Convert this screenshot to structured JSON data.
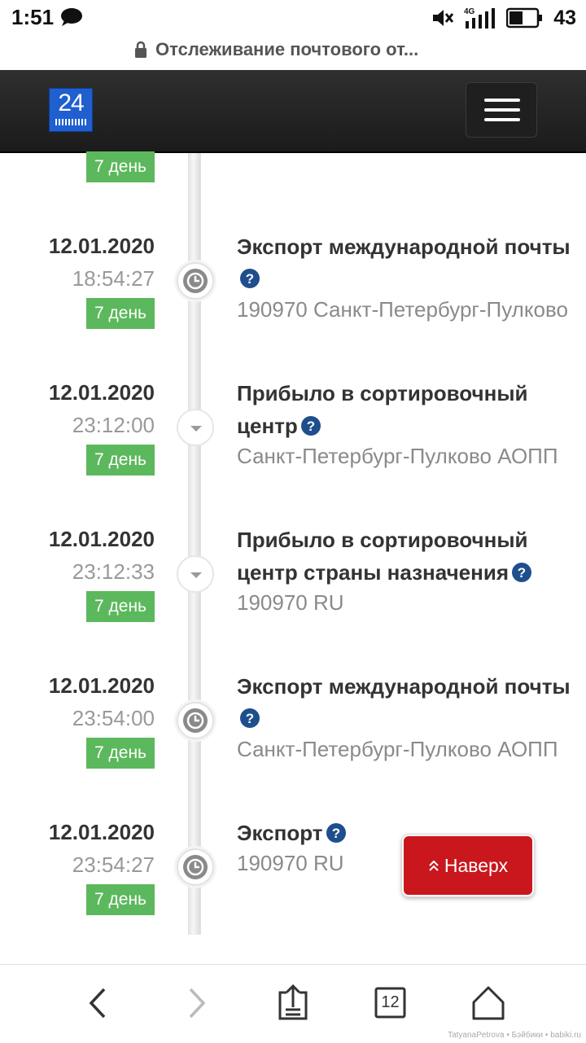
{
  "status_bar": {
    "time": "1:51",
    "battery": "43",
    "network": "4G"
  },
  "url_bar": {
    "title": "Отслеживание почтового от..."
  },
  "header": {
    "logo_text": "24"
  },
  "prev_badge": "7 день",
  "events": [
    {
      "date": "12.01.2020",
      "time": "18:54:27",
      "badge": "7 день",
      "title_lines": [
        "Экспорт международной почты"
      ],
      "location": "190970 Санкт-Петербург-Пулково",
      "icon": "clock-icon"
    },
    {
      "date": "12.01.2020",
      "time": "23:12:00",
      "badge": "7 день",
      "title_lines": [
        "Прибыло в сортировочный",
        "центр"
      ],
      "location": "Санкт-Петербург-Пулково АОПП",
      "icon": "arrow-down-icon"
    },
    {
      "date": "12.01.2020",
      "time": "23:12:33",
      "badge": "7 день",
      "title_lines": [
        "Прибыло в сортировочный",
        "центр страны назначения"
      ],
      "location": "190970 RU",
      "icon": "arrow-down-icon"
    },
    {
      "date": "12.01.2020",
      "time": "23:54:00",
      "badge": "7 день",
      "title_lines": [
        "Экспорт международной почты"
      ],
      "location": "Санкт-Петербург-Пулково АОПП",
      "icon": "clock-icon"
    },
    {
      "date": "12.01.2020",
      "time": "23:54:27",
      "badge": "7 день",
      "title_lines": [
        "Экспорт"
      ],
      "location": "190970 RU",
      "icon": "clock-icon"
    }
  ],
  "scroll_top_button": {
    "label": "Наверх"
  },
  "bottom_nav": {
    "tabs_count": "12"
  },
  "watermark": "TatyanaPetrova • Бэйбики • babiki.ru",
  "colors": {
    "badge": "#5cb85c",
    "help_icon": "#1f4e8c",
    "top_button": "#c9171d",
    "header": "#262626"
  }
}
